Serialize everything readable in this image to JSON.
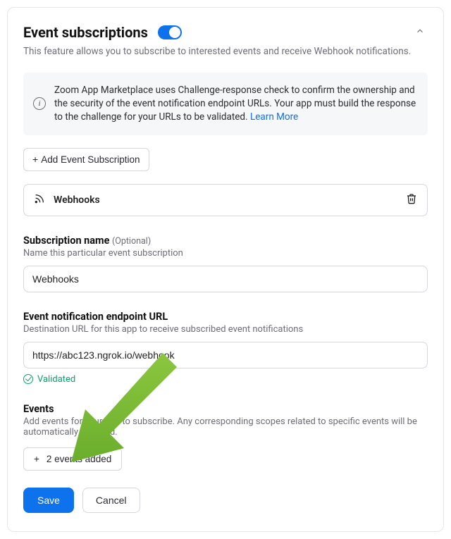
{
  "header": {
    "title": "Event subscriptions",
    "subtitle": "This feature allows you to subscribe to interested events and receive Webhook notifications.",
    "toggle_on": true
  },
  "info": {
    "text_prefix": "Zoom App Marketplace uses Challenge-response check to confirm the ownership and the security of the event notification endpoint URLs. Your app must build the response to the challenge for your URLs to be validated. ",
    "learn_more": "Learn More"
  },
  "add_button": "Add Event Subscription",
  "webhooks_row": "Webhooks",
  "subscription_name": {
    "label": "Subscription name",
    "optional": "(Optional)",
    "desc": "Name this particular event subscription",
    "value": "Webhooks"
  },
  "endpoint": {
    "label": "Event notification endpoint URL",
    "desc": "Destination URL for this app to receive subscribed event notifications",
    "value": "https://abc123.ngrok.io/webhook",
    "validated": "Validated"
  },
  "events": {
    "label": "Events",
    "desc": "Add events for your app to subscribe. Any corresponding scopes related to specific events will be automatically selected.",
    "button": "2 events added"
  },
  "footer": {
    "save": "Save",
    "cancel": "Cancel"
  }
}
